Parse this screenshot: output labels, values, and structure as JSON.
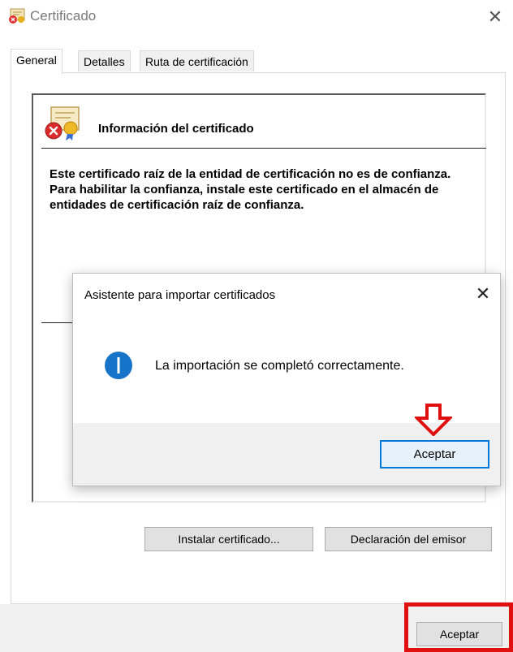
{
  "window": {
    "title": "Certificado",
    "close_icon": "close-icon"
  },
  "tabs": [
    {
      "label": "General",
      "active": true
    },
    {
      "label": "Detalles",
      "active": false
    },
    {
      "label": "Ruta de certificación",
      "active": false
    }
  ],
  "info": {
    "title": "Información del certificado",
    "text": "Este certificado raíz de la entidad de certificación no es de confianza. Para habilitar la confianza, instale este certificado en el almacén de entidades de certificación raíz de confianza.",
    "icon": "certificate-error-icon"
  },
  "buttons": {
    "install": "Instalar certificado...",
    "issuer": "Declaración del emisor",
    "ok": "Aceptar"
  },
  "dialog": {
    "title": "Asistente para importar certificados",
    "message": "La importación se completó correctamente.",
    "ok": "Aceptar",
    "icon": "info-icon"
  },
  "annotations": {
    "highlight_color": "#e01010",
    "arrow_color": "#e01010"
  }
}
